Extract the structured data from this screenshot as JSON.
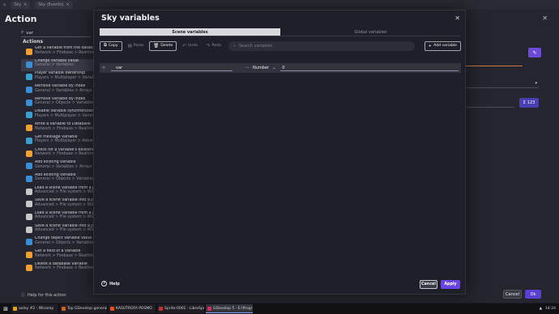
{
  "bg_tabs": [
    "Sky",
    "Sky (Events)"
  ],
  "action_dialog": {
    "title": "Action",
    "search_value": "var",
    "actions_heading": "Actions",
    "help_label": "Help for this action",
    "cancel_label": "Cancel",
    "ok_label": "Ok",
    "items": [
      {
        "title": "Get a variable from the database",
        "path": "Network > Firebase > Realtime d",
        "color": "#f0a030"
      },
      {
        "title": "Change variable value",
        "path": "General > Variables",
        "color": "#3a8ed8",
        "selected": true
      },
      {
        "title": "Player variable ownership",
        "path": "Players > Multiplayer > Variables",
        "color": "#3aa0d0"
      },
      {
        "title": "Remove variable by index",
        "path": "General > Variables > Arrays and",
        "color": "#3a8ed8"
      },
      {
        "title": "Remove variable by index",
        "path": "General > Objects > Variables >",
        "color": "#3a8ed8"
      },
      {
        "title": "Disable variable synchronization",
        "path": "Players > Multiplayer > Variables",
        "color": "#3aa0d0"
      },
      {
        "title": "Write a variable to Database",
        "path": "Network > Firebase > Realtime d",
        "color": "#f0a030"
      },
      {
        "title": "Get message variable",
        "path": "Players > Multiplayer > Advanced",
        "color": "#3aa0d0"
      },
      {
        "title": "Check for a variable's existence",
        "path": "Network > Firebase > Realtime d",
        "color": "#f0a030"
      },
      {
        "title": "Add existing variable",
        "path": "General > Variables > Arrays and",
        "color": "#3a8ed8"
      },
      {
        "title": "Add existing variable",
        "path": "General > Objects > Variables >",
        "color": "#3a8ed8"
      },
      {
        "title": "Load a scene variable from a JSON",
        "path": "Advanced > File system > Windo",
        "color": "#c8c8c8"
      },
      {
        "title": "Save a scene variable into a JSON",
        "path": "Advanced > File system > Windo",
        "color": "#c8c8c8"
      },
      {
        "title": "Load a scene variable from a JSON",
        "path": "Advanced > File system > Windo",
        "color": "#c8c8c8"
      },
      {
        "title": "Save a scene variable into a JSON",
        "path": "Advanced > File system > Windo",
        "color": "#c8c8c8"
      },
      {
        "title": "Change object variable value",
        "path": "General > Objects > Variables",
        "color": "#3a8ed8"
      },
      {
        "title": "Get a field of a variable",
        "path": "Network > Firebase > Realtime d",
        "color": "#f0a030"
      },
      {
        "title": "Delete a database variable",
        "path": "Network > Firebase > Realtime d",
        "color": "#f0a030"
      }
    ]
  },
  "modal": {
    "title": "Sky variables",
    "close": "✕",
    "tabs": [
      {
        "label": "Scene variables",
        "active": true
      },
      {
        "label": "Global variables",
        "active": false
      }
    ],
    "toolbar": {
      "copy": "Copy",
      "paste": "Paste",
      "delete": "Delete",
      "undo": "Undo",
      "redo": "Redo",
      "search_placeholder": "Search variables",
      "add_variable": "Add variable"
    },
    "variable": {
      "name": "var",
      "type": "Number",
      "value": "0"
    },
    "help": "Help",
    "cancel": "Cancel",
    "apply": "Apply"
  },
  "taskbar": {
    "items": [
      {
        "label": "aoley #2 - Winamp",
        "color": "#e0a020"
      },
      {
        "label": "Top GDevelop general",
        "color": "#d06020"
      },
      {
        "label": "KASUTROFA POSMO",
        "color": "#e05020"
      },
      {
        "label": "Sprite-0001 - LibreSpr",
        "color": "#c03030"
      },
      {
        "label": "GDevelop 5 - E:\\Progr",
        "color": "#d03060",
        "active": true
      }
    ],
    "time": "14:24"
  },
  "colors": {
    "accent": "#6a44e0",
    "orange_underline": "#d27a3a"
  }
}
